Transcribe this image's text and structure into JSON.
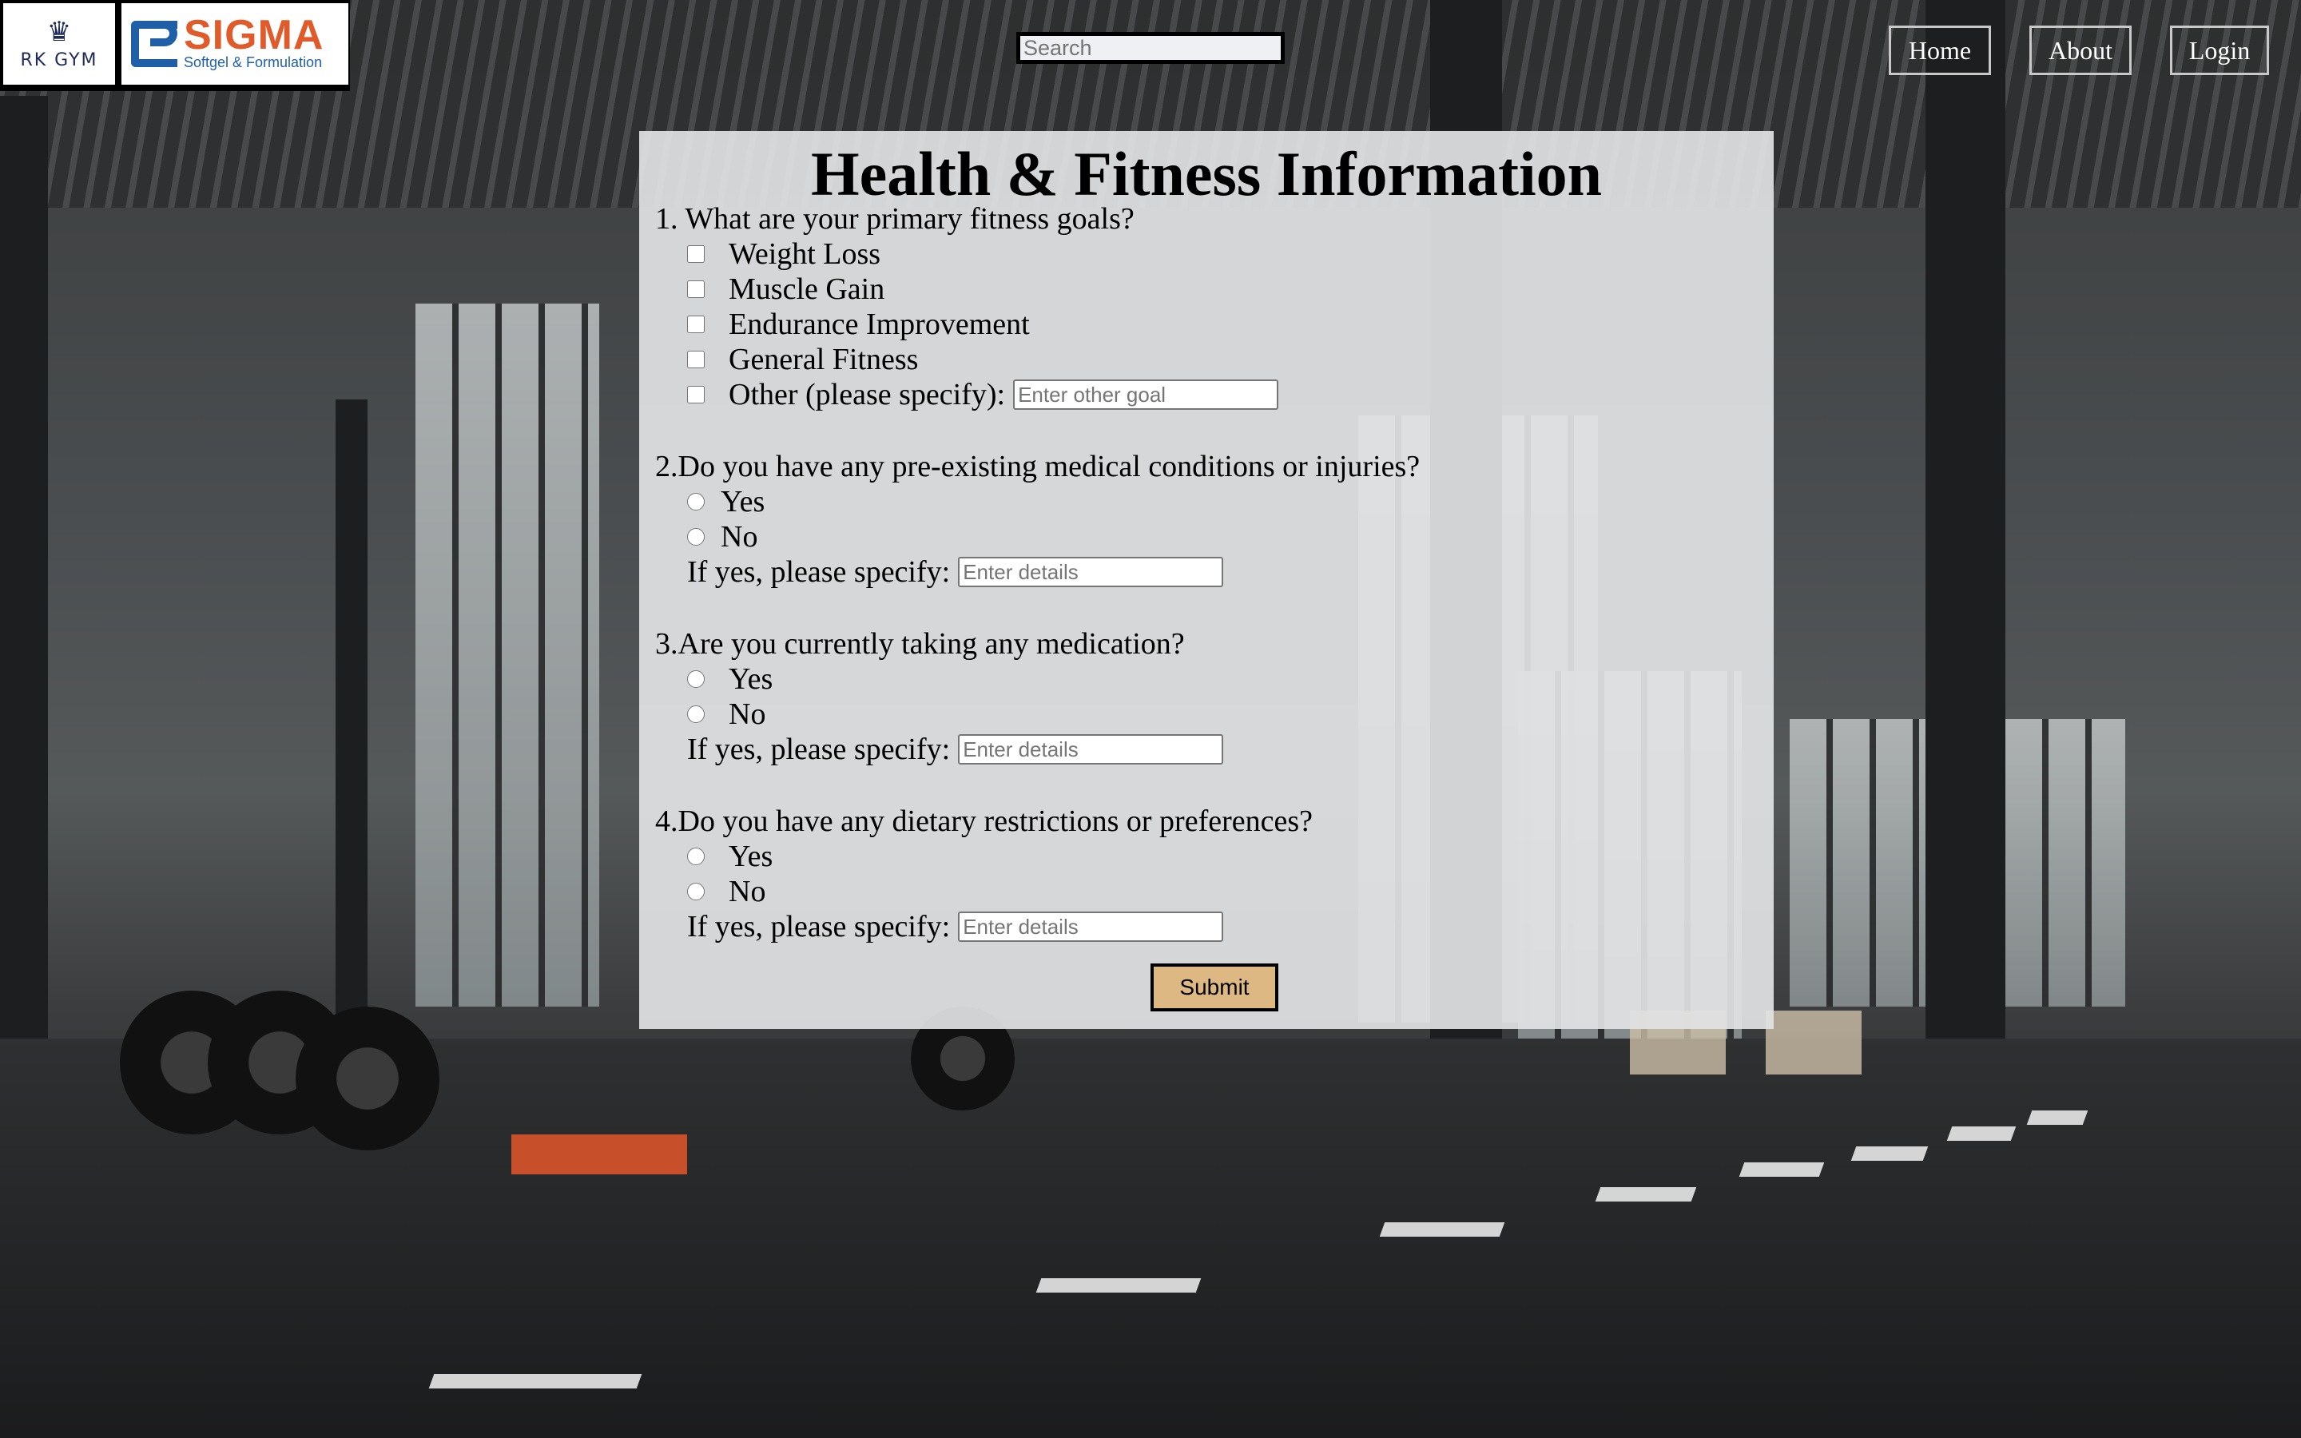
{
  "brand": {
    "gym_logo_text": "RK GYM",
    "partner_name": "SIGMA",
    "partner_tagline": "Softgel & Formulation"
  },
  "search": {
    "placeholder": "Search",
    "value": ""
  },
  "nav": {
    "home": "Home",
    "about": "About",
    "login": "Login"
  },
  "form": {
    "title": "Health & Fitness Information",
    "q1": {
      "label": "1. What are your primary fitness goals?",
      "options": [
        "Weight Loss",
        "Muscle Gain",
        "Endurance Improvement",
        "General Fitness",
        "Other (please specify):"
      ],
      "other_placeholder": "Enter other goal"
    },
    "q2": {
      "label": "2.Do you have any pre-existing medical conditions or injuries?",
      "yes": "Yes",
      "no": "No",
      "specify_label": "If yes, please specify:",
      "placeholder": "Enter details"
    },
    "q3": {
      "label": "3.Are you currently taking any medication?",
      "yes": "Yes",
      "no": "No",
      "specify_label": "If yes, please specify:",
      "placeholder": "Enter details"
    },
    "q4": {
      "label": "4.Do you have any dietary restrictions or preferences?",
      "yes": "Yes",
      "no": "No",
      "specify_label": "If yes, please specify:",
      "placeholder": "Enter details"
    },
    "submit_label": "Submit"
  },
  "colors": {
    "submit_bg": "#ddb883",
    "panel_bg": "#e2e3e4",
    "sigma_orange": "#e05a2a",
    "sigma_blue": "#1f5fa8"
  }
}
